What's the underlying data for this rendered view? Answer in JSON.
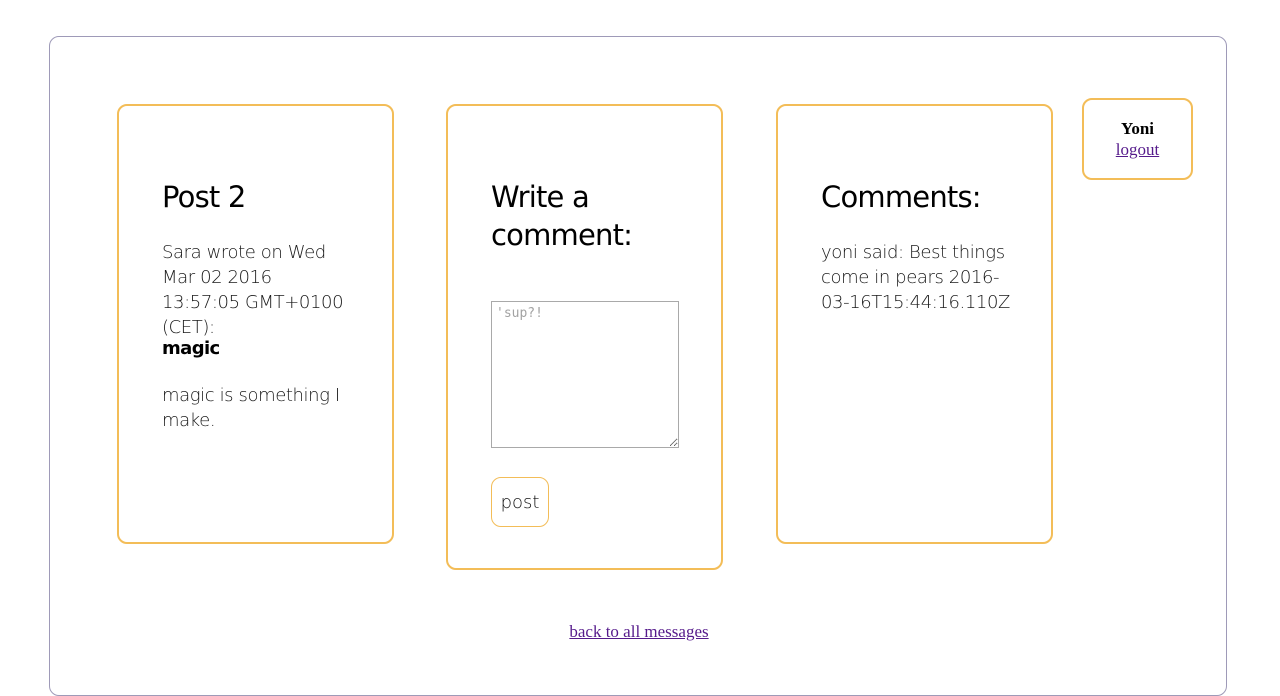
{
  "post": {
    "title": "Post 2",
    "meta": "Sara wrote on Wed Mar 02 2016 13:57:05 GMT+0100 (CET):",
    "subject": "magic",
    "body": "magic is something I make."
  },
  "write_comment": {
    "heading": "Write a comment:",
    "textarea_placeholder": "'sup?!",
    "textarea_value": "",
    "post_label": "post"
  },
  "comments": {
    "heading": "Comments:",
    "items": [
      {
        "text": "yoni said: Best things come in pears 2016-03-16T15:44:16.110Z"
      }
    ]
  },
  "user": {
    "name": "Yoni",
    "logout_label": "logout"
  },
  "footer": {
    "back_label": "back to all messages"
  },
  "colors": {
    "card_border": "#f3bd58",
    "frame_border": "#9e9ab8",
    "link": "#551a8b"
  }
}
